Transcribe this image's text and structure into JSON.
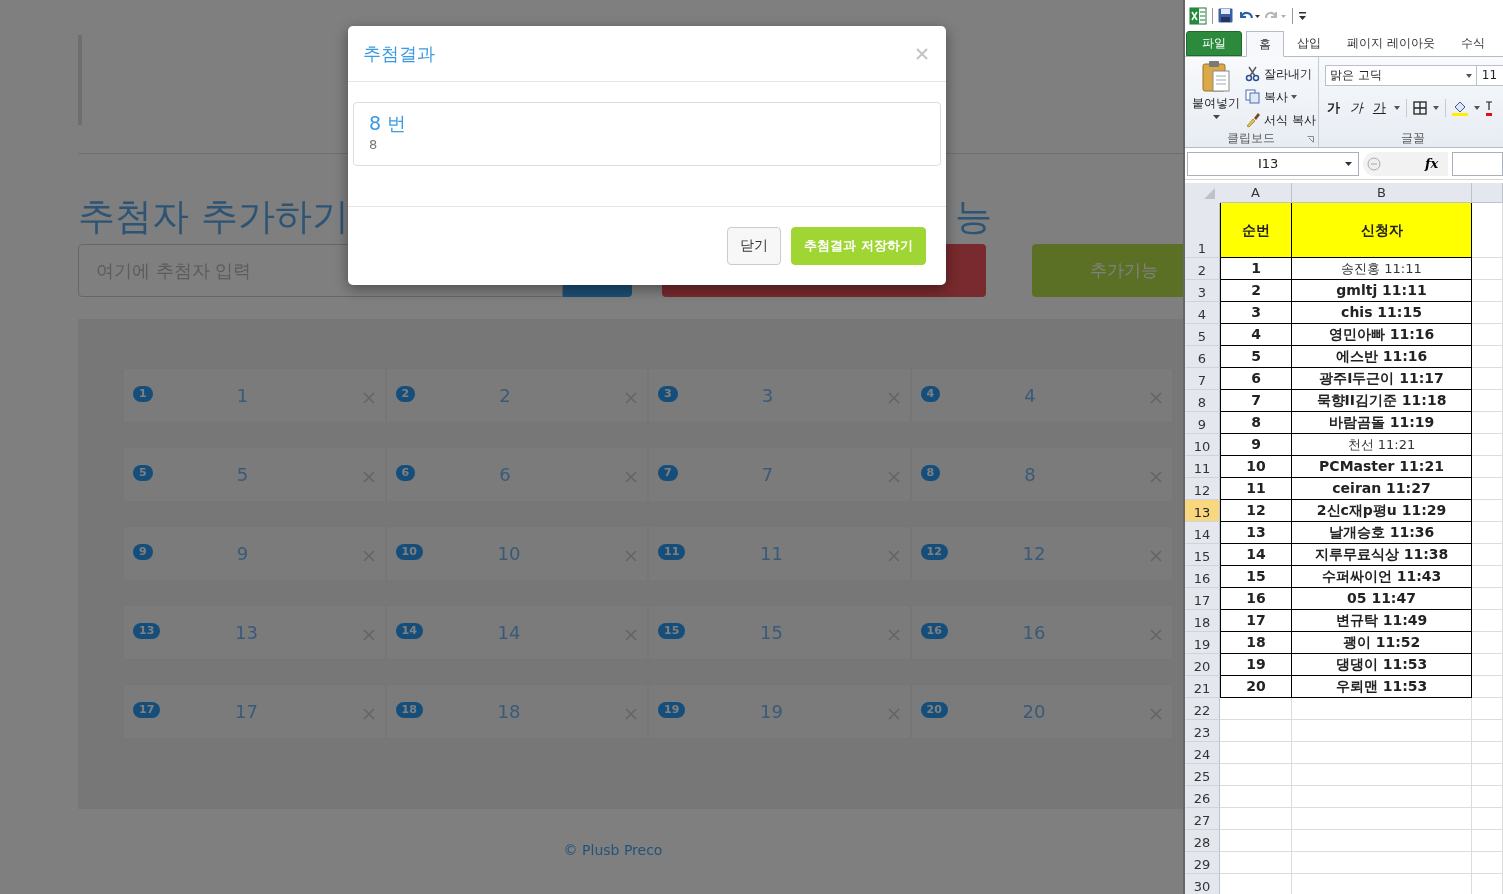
{
  "page": {
    "heading": "추첨자 추가하기",
    "heading_2": "능",
    "input": {
      "placeholder": "여기에 추첨자 입력"
    },
    "extra_button": "추가기능",
    "cards": [
      {
        "badge": "1",
        "name": "1"
      },
      {
        "badge": "2",
        "name": "2"
      },
      {
        "badge": "3",
        "name": "3"
      },
      {
        "badge": "4",
        "name": "4"
      },
      {
        "badge": "5",
        "name": "5"
      },
      {
        "badge": "6",
        "name": "6"
      },
      {
        "badge": "7",
        "name": "7"
      },
      {
        "badge": "8",
        "name": "8"
      },
      {
        "badge": "9",
        "name": "9"
      },
      {
        "badge": "10",
        "name": "10"
      },
      {
        "badge": "11",
        "name": "11"
      },
      {
        "badge": "12",
        "name": "12"
      },
      {
        "badge": "13",
        "name": "13"
      },
      {
        "badge": "14",
        "name": "14"
      },
      {
        "badge": "15",
        "name": "15"
      },
      {
        "badge": "16",
        "name": "16"
      },
      {
        "badge": "17",
        "name": "17"
      },
      {
        "badge": "18",
        "name": "18"
      },
      {
        "badge": "19",
        "name": "19"
      },
      {
        "badge": "20",
        "name": "20"
      }
    ],
    "footer": "© Plusb Preco"
  },
  "modal": {
    "title": "추첨결과",
    "result": {
      "title": "8 번",
      "text": "8"
    },
    "buttons": [
      {
        "label": "닫기",
        "kind": "default"
      },
      {
        "label": "추첨결과 저장하기",
        "kind": "primary"
      }
    ]
  },
  "excel": {
    "tabs": [
      {
        "label": "파일",
        "kind": "file",
        "selected": false
      },
      {
        "label": "홈",
        "kind": "tab",
        "selected": true
      },
      {
        "label": "삽입",
        "kind": "tab",
        "selected": false
      },
      {
        "label": "페이지 레이아웃",
        "kind": "tab",
        "selected": false
      },
      {
        "label": "수식",
        "kind": "tab",
        "selected": false
      }
    ],
    "clipboard": {
      "paste": "붙여넣기",
      "items": [
        {
          "label": "잘라내기",
          "kind": "cut"
        },
        {
          "label": "복사",
          "kind": "copy"
        },
        {
          "label": "서식 복사",
          "kind": "format"
        }
      ],
      "label": "클립보드"
    },
    "font": {
      "name": "맑은 고딕",
      "size": "11",
      "styles": [
        {
          "label": "가",
          "kind": "bold"
        },
        {
          "label": "가",
          "kind": "italic"
        },
        {
          "label": "가",
          "kind": "underline"
        }
      ],
      "label": "글꼴"
    },
    "name_box": "I13",
    "function_label": "fx",
    "columns": [
      "A",
      "B"
    ],
    "rows": [
      {
        "header": "1",
        "kind": "header",
        "selected": false,
        "a": "순번",
        "b": "신청자"
      },
      {
        "header": "2",
        "kind": "data",
        "selected": false,
        "a": "1",
        "b": "송진홍 11:11",
        "bold": false
      },
      {
        "header": "3",
        "kind": "data",
        "selected": false,
        "a": "2",
        "b": "gmltj 11:11",
        "bold": true
      },
      {
        "header": "4",
        "kind": "data",
        "selected": false,
        "a": "3",
        "b": "chis 11:15",
        "bold": true
      },
      {
        "header": "5",
        "kind": "data",
        "selected": false,
        "a": "4",
        "b": "영민아빠 11:16",
        "bold": true
      },
      {
        "header": "6",
        "kind": "data",
        "selected": false,
        "a": "5",
        "b": "에스반 11:16",
        "bold": true
      },
      {
        "header": "7",
        "kind": "data",
        "selected": false,
        "a": "6",
        "b": "광주I두근이 11:17",
        "bold": true
      },
      {
        "header": "8",
        "kind": "data",
        "selected": false,
        "a": "7",
        "b": "묵향II김기준 11:18",
        "bold": true
      },
      {
        "header": "9",
        "kind": "data",
        "selected": false,
        "a": "8",
        "b": "바람곰돌 11:19",
        "bold": true
      },
      {
        "header": "10",
        "kind": "data",
        "selected": false,
        "a": "9",
        "b": "천선 11:21",
        "bold": false
      },
      {
        "header": "11",
        "kind": "data",
        "selected": false,
        "a": "10",
        "b": "PCMaster 11:21",
        "bold": true
      },
      {
        "header": "12",
        "kind": "data",
        "selected": false,
        "a": "11",
        "b": "ceiran 11:27",
        "bold": true
      },
      {
        "header": "13",
        "kind": "data",
        "selected": true,
        "a": "12",
        "b": "2신c재p평u 11:29",
        "bold": true
      },
      {
        "header": "14",
        "kind": "data",
        "selected": false,
        "a": "13",
        "b": "날개승호 11:36",
        "bold": true
      },
      {
        "header": "15",
        "kind": "data",
        "selected": false,
        "a": "14",
        "b": "지루무료식상 11:38",
        "bold": true
      },
      {
        "header": "16",
        "kind": "data",
        "selected": false,
        "a": "15",
        "b": "수퍼싸이언 11:43",
        "bold": true
      },
      {
        "header": "17",
        "kind": "data",
        "selected": false,
        "a": "16",
        "b": "05 11:47",
        "bold": true
      },
      {
        "header": "18",
        "kind": "data",
        "selected": false,
        "a": "17",
        "b": "변규탁 11:49",
        "bold": true
      },
      {
        "header": "19",
        "kind": "data",
        "selected": false,
        "a": "18",
        "b": "괭이 11:52",
        "bold": true
      },
      {
        "header": "20",
        "kind": "data",
        "selected": false,
        "a": "19",
        "b": "댕댕이 11:53",
        "bold": true
      },
      {
        "header": "21",
        "kind": "data",
        "selected": false,
        "a": "20",
        "b": "우뢰맨 11:53",
        "bold": true
      },
      {
        "header": "22",
        "kind": "empty",
        "selected": false
      },
      {
        "header": "23",
        "kind": "empty",
        "selected": false
      },
      {
        "header": "24",
        "kind": "empty",
        "selected": false
      },
      {
        "header": "25",
        "kind": "empty",
        "selected": false
      },
      {
        "header": "26",
        "kind": "empty",
        "selected": false
      },
      {
        "header": "27",
        "kind": "empty",
        "selected": false
      },
      {
        "header": "28",
        "kind": "empty",
        "selected": false
      },
      {
        "header": "29",
        "kind": "empty",
        "selected": false
      },
      {
        "header": "30",
        "kind": "empty",
        "selected": false
      }
    ]
  }
}
